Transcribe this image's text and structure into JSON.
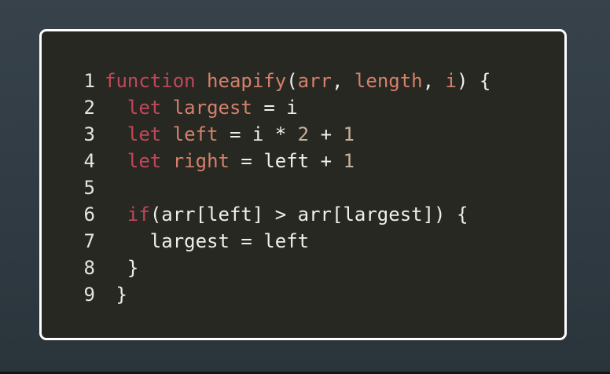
{
  "editor": {
    "lines": [
      {
        "number": "1",
        "tokens": [
          {
            "t": "function",
            "k": "kw"
          },
          {
            "t": " ",
            "k": "plain"
          },
          {
            "t": "heapify",
            "k": "fn"
          },
          {
            "t": "(",
            "k": "plain"
          },
          {
            "t": "arr",
            "k": "pm"
          },
          {
            "t": ", ",
            "k": "plain"
          },
          {
            "t": "length",
            "k": "pm"
          },
          {
            "t": ", ",
            "k": "plain"
          },
          {
            "t": "i",
            "k": "pm"
          },
          {
            "t": ") {",
            "k": "plain"
          }
        ]
      },
      {
        "number": "2",
        "tokens": [
          {
            "t": "  ",
            "k": "plain"
          },
          {
            "t": "let",
            "k": "kw"
          },
          {
            "t": " ",
            "k": "plain"
          },
          {
            "t": "largest",
            "k": "pm"
          },
          {
            "t": " = i",
            "k": "plain"
          }
        ]
      },
      {
        "number": "3",
        "tokens": [
          {
            "t": "  ",
            "k": "plain"
          },
          {
            "t": "let",
            "k": "kw"
          },
          {
            "t": " ",
            "k": "plain"
          },
          {
            "t": "left",
            "k": "pm"
          },
          {
            "t": " = i * ",
            "k": "plain"
          },
          {
            "t": "2",
            "k": "num"
          },
          {
            "t": " + ",
            "k": "plain"
          },
          {
            "t": "1",
            "k": "num"
          }
        ]
      },
      {
        "number": "4",
        "tokens": [
          {
            "t": "  ",
            "k": "plain"
          },
          {
            "t": "let",
            "k": "kw"
          },
          {
            "t": " ",
            "k": "plain"
          },
          {
            "t": "right",
            "k": "pm"
          },
          {
            "t": " = left + ",
            "k": "plain"
          },
          {
            "t": "1",
            "k": "num"
          }
        ]
      },
      {
        "number": "5",
        "tokens": []
      },
      {
        "number": "6",
        "tokens": [
          {
            "t": "  ",
            "k": "plain"
          },
          {
            "t": "if",
            "k": "kw"
          },
          {
            "t": "(arr[left] > arr[largest]) {",
            "k": "plain"
          }
        ]
      },
      {
        "number": "7",
        "tokens": [
          {
            "t": "    largest = left",
            "k": "plain"
          }
        ]
      },
      {
        "number": "8",
        "tokens": [
          {
            "t": "  }",
            "k": "plain"
          }
        ]
      },
      {
        "number": "9",
        "tokens": [
          {
            "t": " }",
            "k": "plain"
          }
        ]
      }
    ]
  },
  "colors": {
    "background": "#333e46",
    "editor_bg": "#282823",
    "border": "#ffffff",
    "keyword": "#c2475a",
    "identifier": "#d5806a",
    "number": "#c7b29a",
    "text": "#efefea"
  }
}
